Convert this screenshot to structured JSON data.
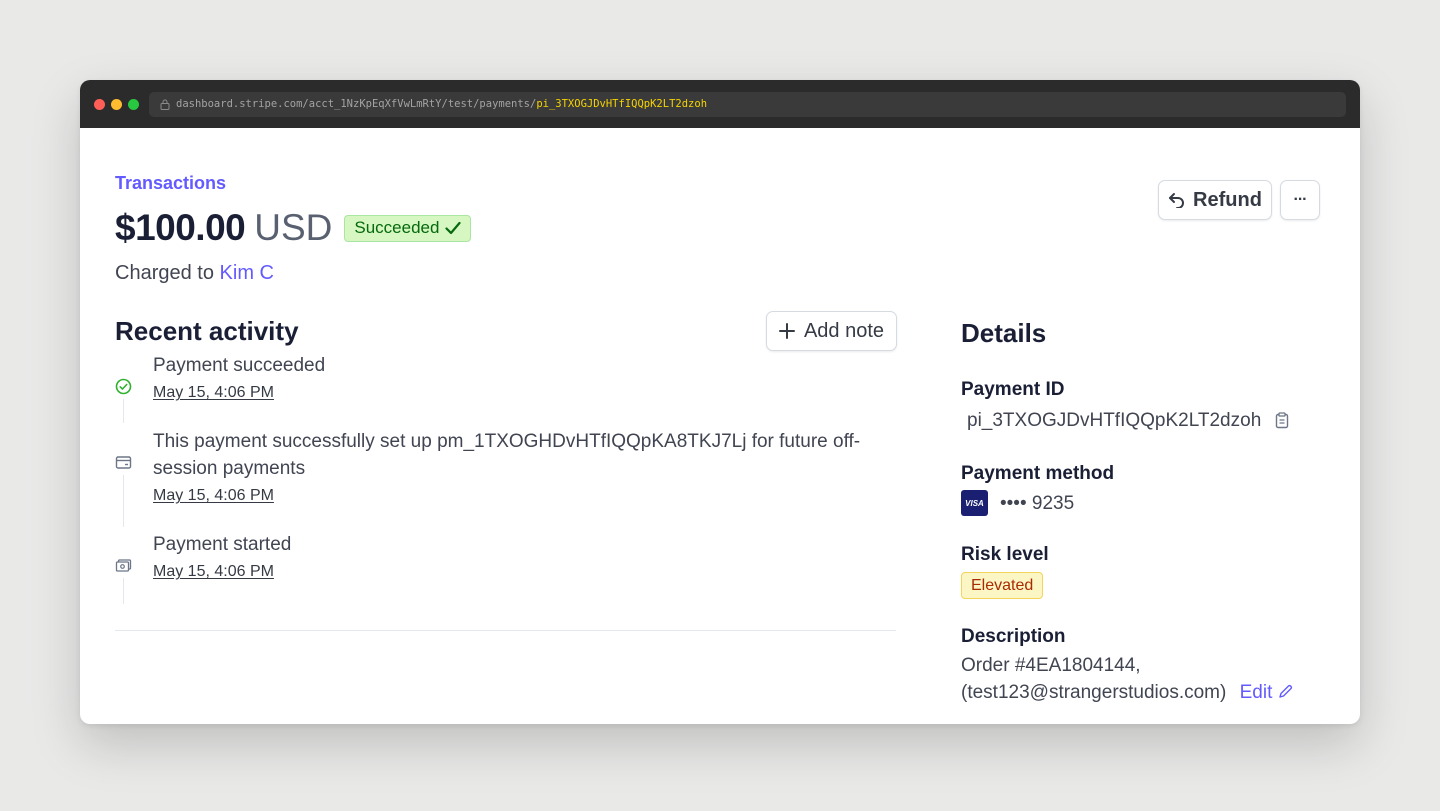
{
  "browser": {
    "url_prefix": "dashboard.stripe.com/acct_1NzKpEqXfVwLmRtY/test/payments/",
    "url_highlight": "pi_3TXOGJDvHTfIQQpK2LT2dzoh"
  },
  "header": {
    "breadcrumb": "Transactions",
    "amount": "$100.00",
    "currency": "USD",
    "status": "Succeeded",
    "charged_prefix": "Charged to",
    "customer": "Kim C"
  },
  "actions": {
    "refund_label": "Refund",
    "more_label": "···"
  },
  "activity": {
    "title": "Recent activity",
    "add_note_label": "Add note",
    "items": [
      {
        "icon": "check-circle-icon",
        "text": "Payment succeeded",
        "date": "May 15, 4:06 PM"
      },
      {
        "icon": "card-icon",
        "text": "This payment successfully set up pm_1TXOGHDvHTfIQQpKA8TKJ7Lj for future off-session payments",
        "date": "May 15, 4:06 PM"
      },
      {
        "icon": "cash-icon",
        "text": "Payment started",
        "date": "May 15, 4:06 PM"
      }
    ]
  },
  "details": {
    "title": "Details",
    "payment_id_label": "Payment ID",
    "payment_id": "pi_3TXOGJDvHTfIQQpK2LT2dzoh",
    "payment_method_label": "Payment method",
    "card_brand": "VISA",
    "card_masked": "•••• 9235",
    "risk_label": "Risk level",
    "risk_value": "Elevated",
    "description_label": "Description",
    "description_line1": "Order #4EA1804144,",
    "description_line2": "(test123@strangerstudios.com)",
    "edit_label": "Edit"
  },
  "colors": {
    "accent": "#635bff",
    "success_bg": "#d7f7c2",
    "success_text": "#05690d",
    "warning_bg": "#fcf5c4",
    "warning_text": "#a82c00"
  }
}
